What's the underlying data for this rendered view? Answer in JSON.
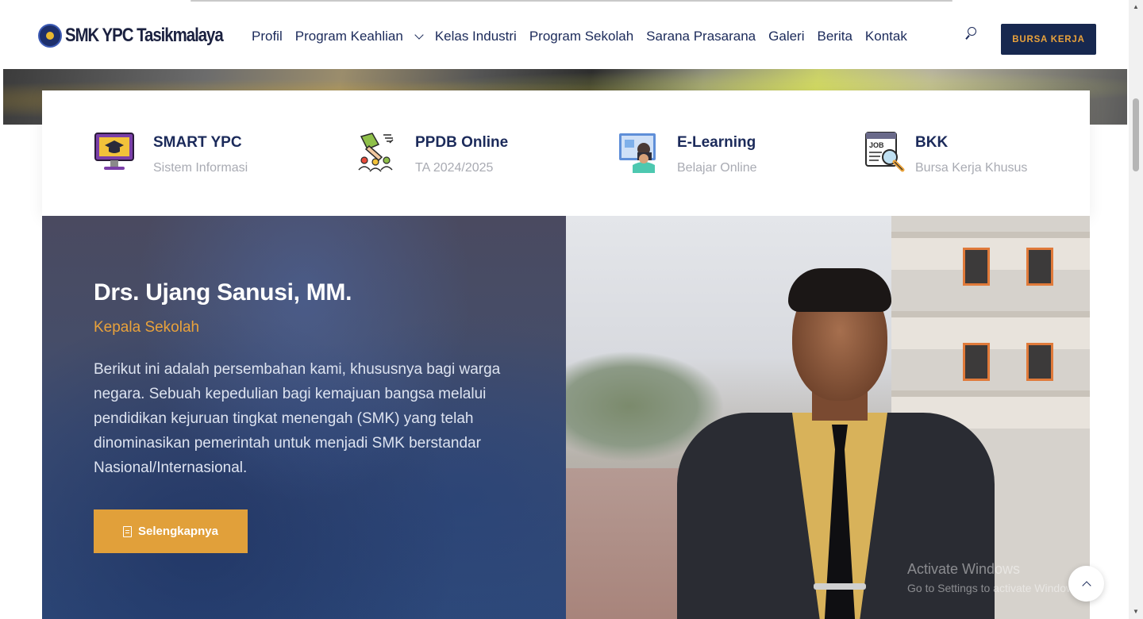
{
  "header": {
    "logo_text": "SMK YPC Tasikmalaya",
    "nav": [
      {
        "label": "Profil"
      },
      {
        "label": "Program Keahlian",
        "has_dropdown": true
      },
      {
        "label": "Kelas Industri"
      },
      {
        "label": "Program Sekolah"
      },
      {
        "label": "Sarana Prasarana"
      },
      {
        "label": "Galeri"
      },
      {
        "label": "Berita"
      },
      {
        "label": "Kontak"
      }
    ],
    "search_icon": "search-icon",
    "cta_label": "BURSA KERJA"
  },
  "features": [
    {
      "title": "SMART YPC",
      "subtitle": "Sistem Informasi",
      "icon": "monitor-graduation-icon"
    },
    {
      "title": "PPDB Online",
      "subtitle": "TA 2024/2025",
      "icon": "registration-icon"
    },
    {
      "title": "E-Learning",
      "subtitle": "Belajar Online",
      "icon": "elearning-icon"
    },
    {
      "title": "BKK",
      "subtitle": "Bursa Kerja Khusus",
      "icon": "job-search-icon"
    }
  ],
  "hero": {
    "name": "Drs. Ujang Sanusi, MM.",
    "role": "Kepala Sekolah",
    "description": "Berikut ini adalah persembahan kami, khususnya bagi warga negara. Sebuah kepedulian bagi kemajuan bangsa melalui pendidikan kejuruan tingkat menengah (SMK) yang telah dinominasikan pemerintah untuk menjadi SMK berstandar Nasional/Internasional.",
    "button_label": "Selengkapnya"
  },
  "overlay": {
    "watermark_line1": "Activate Windows",
    "watermark_line2": "Go to Settings to activate Windows."
  },
  "colors": {
    "navy": "#17284f",
    "accent": "#e1a03a",
    "text_dark": "#1b2a5a",
    "muted": "#a9abb3"
  }
}
